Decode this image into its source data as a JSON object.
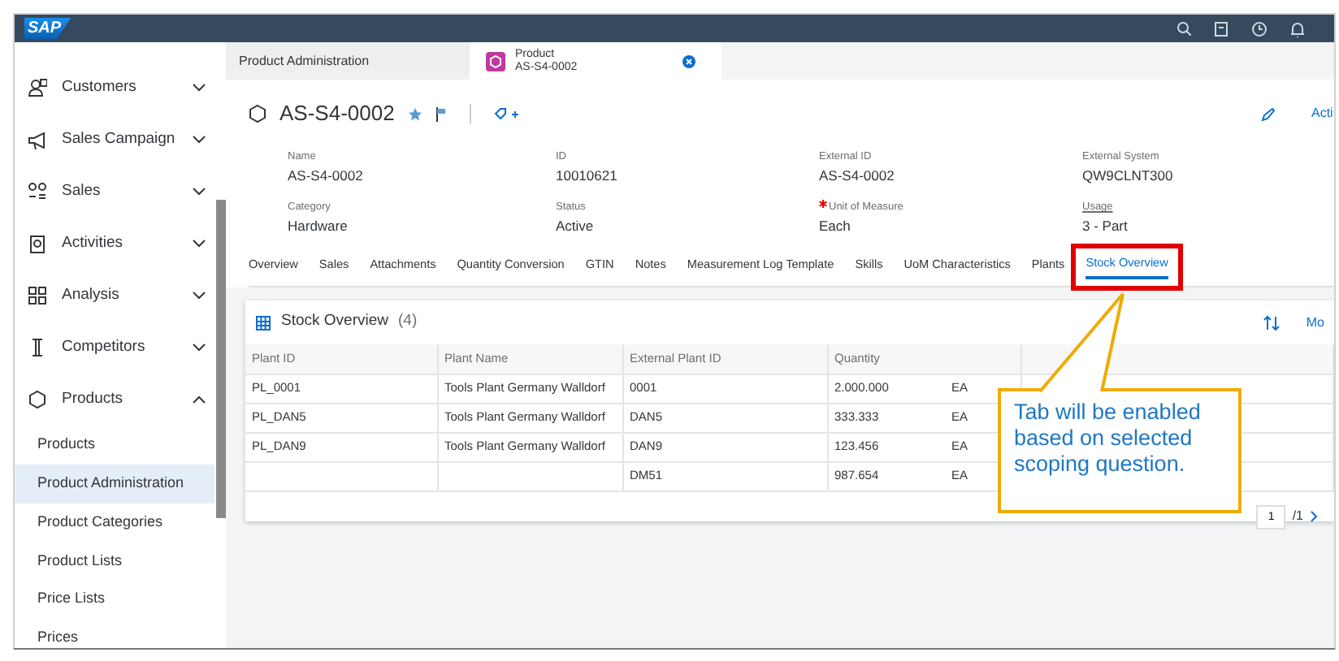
{
  "shell": {
    "logo": "SAP"
  },
  "sidebar": {
    "items": [
      {
        "label": "Customers",
        "expanded": false
      },
      {
        "label": "Sales Campaign",
        "expanded": false
      },
      {
        "label": "Sales",
        "expanded": false
      },
      {
        "label": "Activities",
        "expanded": false
      },
      {
        "label": "Analysis",
        "expanded": false
      },
      {
        "label": "Competitors",
        "expanded": false
      },
      {
        "label": "Products",
        "expanded": true,
        "children": [
          {
            "label": "Products",
            "selected": false
          },
          {
            "label": "Product Administration",
            "selected": true
          },
          {
            "label": "Product Categories",
            "selected": false
          },
          {
            "label": "Product Lists",
            "selected": false
          },
          {
            "label": "Price Lists",
            "selected": false
          },
          {
            "label": "Prices",
            "selected": false
          }
        ]
      }
    ]
  },
  "tabs": [
    {
      "title": "Product Administration",
      "selected": false
    },
    {
      "title": "Product",
      "subtitle": "AS-S4-0002",
      "selected": true
    }
  ],
  "header": {
    "title": "AS-S4-0002",
    "action": "Acti",
    "fields": [
      {
        "label": "Name",
        "value": "AS-S4-0002"
      },
      {
        "label": "ID",
        "value": "10010621"
      },
      {
        "label": "External ID",
        "value": "AS-S4-0002"
      },
      {
        "label": "External System",
        "value": "QW9CLNT300"
      },
      {
        "label": "Category",
        "value": "Hardware"
      },
      {
        "label": "Status",
        "value": "Active"
      },
      {
        "label": "Unit of Measure",
        "value": "Each",
        "required": true
      },
      {
        "label": "Usage",
        "value": "3 - Part",
        "link": true
      }
    ]
  },
  "section_tabs": [
    {
      "label": "Overview",
      "selected": false
    },
    {
      "label": "Sales",
      "selected": false
    },
    {
      "label": "Attachments",
      "selected": false
    },
    {
      "label": "Quantity Conversion",
      "selected": false
    },
    {
      "label": "GTIN",
      "selected": false
    },
    {
      "label": "Notes",
      "selected": false
    },
    {
      "label": "Measurement Log Template",
      "selected": false
    },
    {
      "label": "Skills",
      "selected": false
    },
    {
      "label": "UoM Characteristics",
      "selected": false
    },
    {
      "label": "Plants",
      "selected": false
    },
    {
      "label": "Stock Overview",
      "selected": true
    }
  ],
  "stock_table": {
    "title": "Stock Overview",
    "count": "(4)",
    "more": "Mo",
    "columns": [
      "Plant ID",
      "Plant Name",
      "External Plant ID",
      "Quantity"
    ],
    "rows": [
      {
        "plant_id": "PL_0001",
        "plant_name": "Tools Plant Germany Walldorf",
        "external_id": "0001",
        "quantity": "2.000.000",
        "unit": "EA"
      },
      {
        "plant_id": "PL_DAN5",
        "plant_name": "Tools Plant Germany Walldorf",
        "external_id": "DAN5",
        "quantity": "333.333",
        "unit": "EA"
      },
      {
        "plant_id": "PL_DAN9",
        "plant_name": "Tools Plant Germany Walldorf",
        "external_id": "DAN9",
        "quantity": "123.456",
        "unit": "EA"
      },
      {
        "external_id": "DM51",
        "quantity": "987.654",
        "unit": "EA"
      }
    ],
    "page": "1",
    "page_total": "/1"
  },
  "callout": {
    "text": "Tab will be enabled based on selected scoping question."
  }
}
